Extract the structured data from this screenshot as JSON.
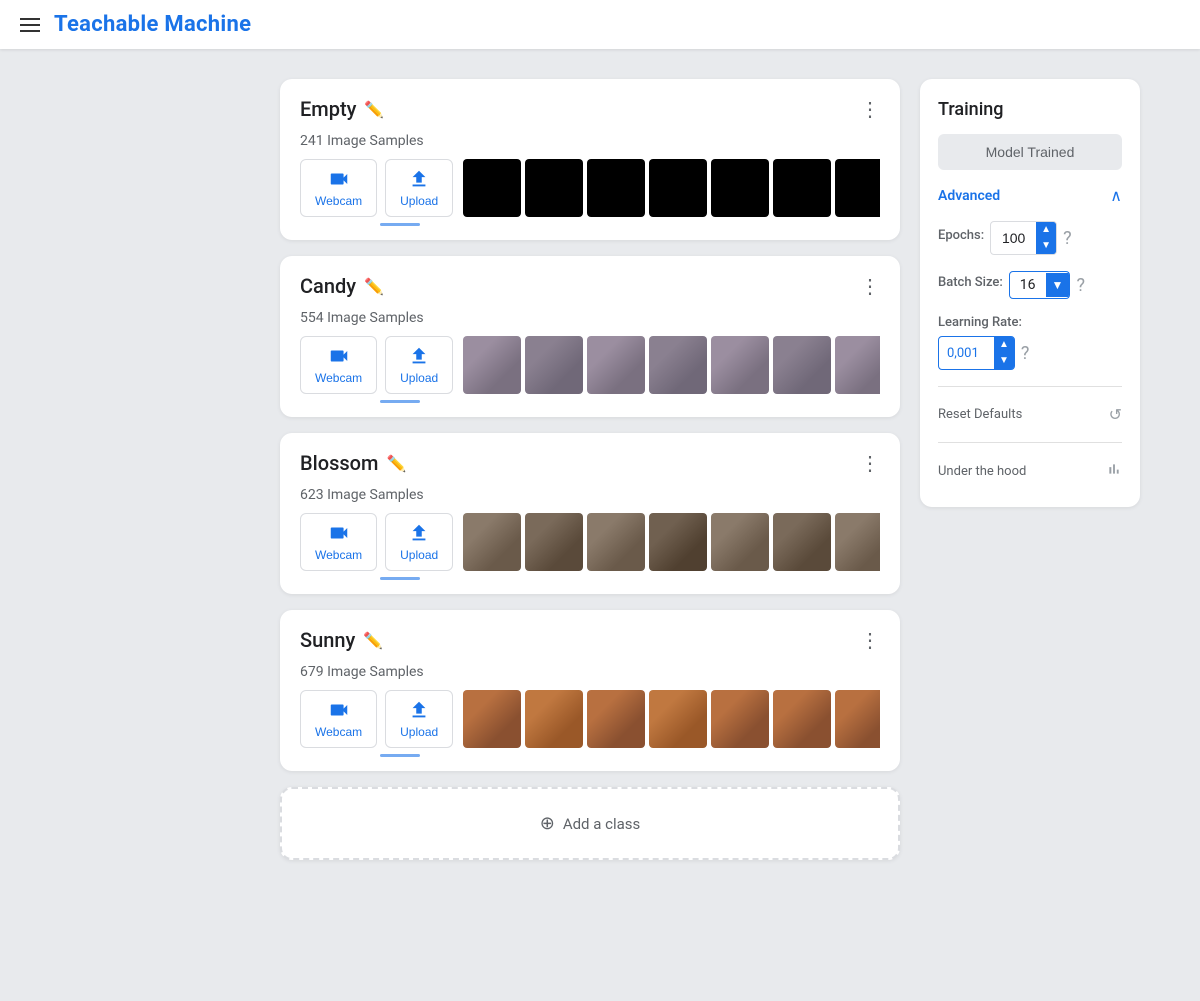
{
  "app": {
    "title": "Teachable Machine"
  },
  "header": {
    "menu_icon": "hamburger"
  },
  "classes": [
    {
      "name": "Empty",
      "sample_count": "241 Image Samples",
      "image_type": "black",
      "image_count": 7
    },
    {
      "name": "Candy",
      "sample_count": "554 Image Samples",
      "image_type": "candy",
      "image_count": 7
    },
    {
      "name": "Blossom",
      "sample_count": "623 Image Samples",
      "image_type": "blossom",
      "image_count": 7
    },
    {
      "name": "Sunny",
      "sample_count": "679 Image Samples",
      "image_type": "sunny",
      "image_count": 7
    }
  ],
  "add_class": {
    "label": "Add a class"
  },
  "training": {
    "title": "Training",
    "train_button": "Model Trained",
    "advanced_label": "Advanced",
    "epochs_label": "Epochs:",
    "epochs_value": "100",
    "batch_size_label": "Batch Size:",
    "batch_size_value": "16",
    "learning_rate_label": "Learning Rate:",
    "learning_rate_value": "0,001",
    "reset_defaults_label": "Reset Defaults",
    "under_hood_label": "Under the hood"
  },
  "webcam_label": "Webcam",
  "upload_label": "Upload"
}
